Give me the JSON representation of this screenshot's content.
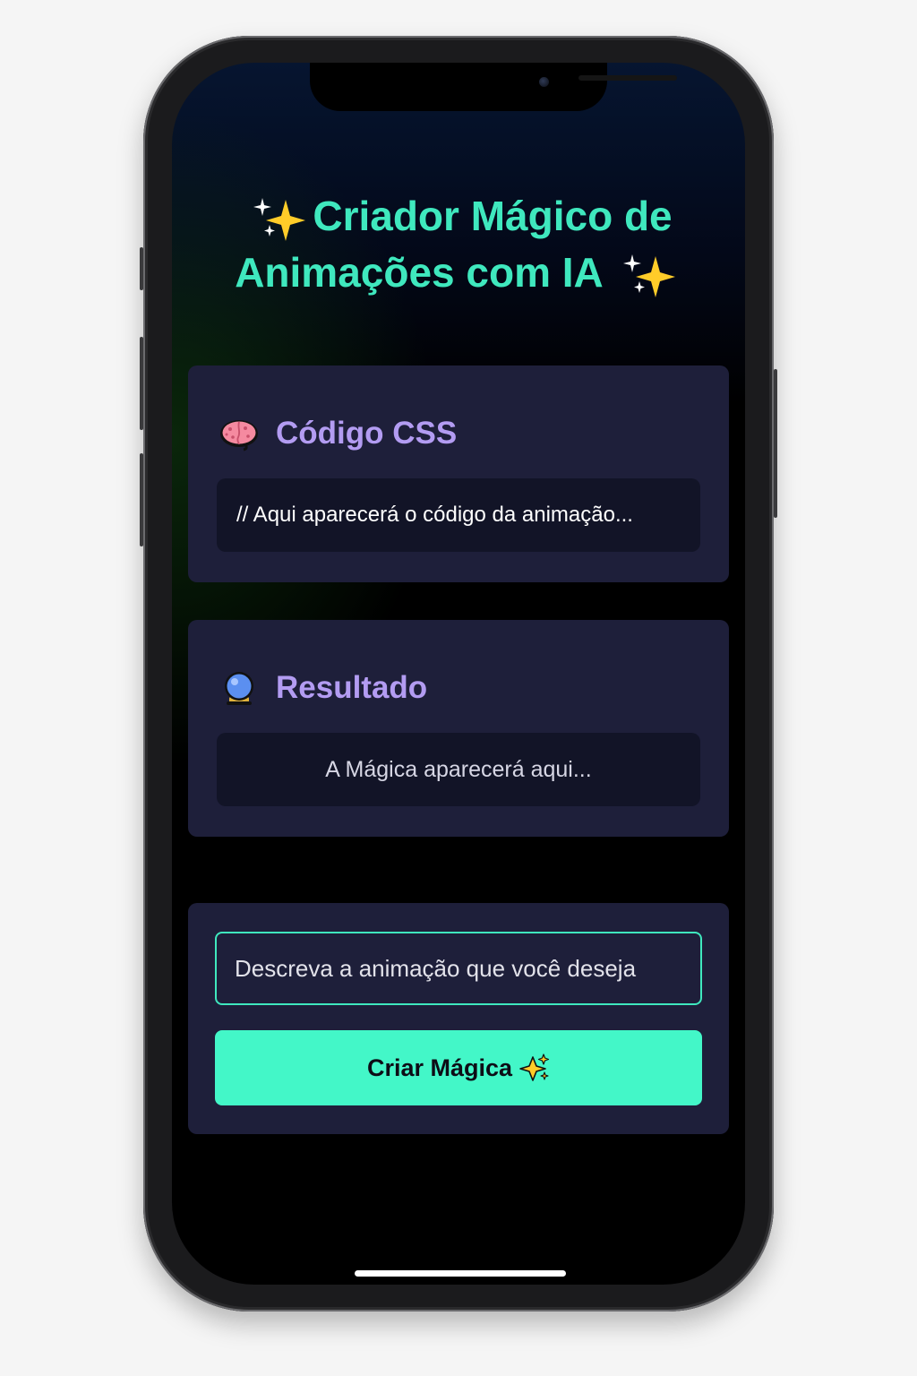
{
  "header": {
    "title_line1": "Criador Mágico de",
    "title_line2": "Animações com IA"
  },
  "code_card": {
    "heading": "Código CSS",
    "icon": "brain-icon",
    "placeholder": "// Aqui aparecerá o código da animação..."
  },
  "result_card": {
    "heading": "Resultado",
    "icon": "crystal-ball-icon",
    "placeholder": "A Mágica aparecerá aqui..."
  },
  "prompt": {
    "input_placeholder": "Descreva a animação que você deseja",
    "input_value": "",
    "button_label": "Criar Mágica",
    "button_icon": "sparkles-icon"
  },
  "colors": {
    "accent": "#43f7c8",
    "title": "#3fe8be",
    "heading": "#b39cf2",
    "card_bg": "#1e1f3a",
    "panel_bg": "#121427"
  }
}
